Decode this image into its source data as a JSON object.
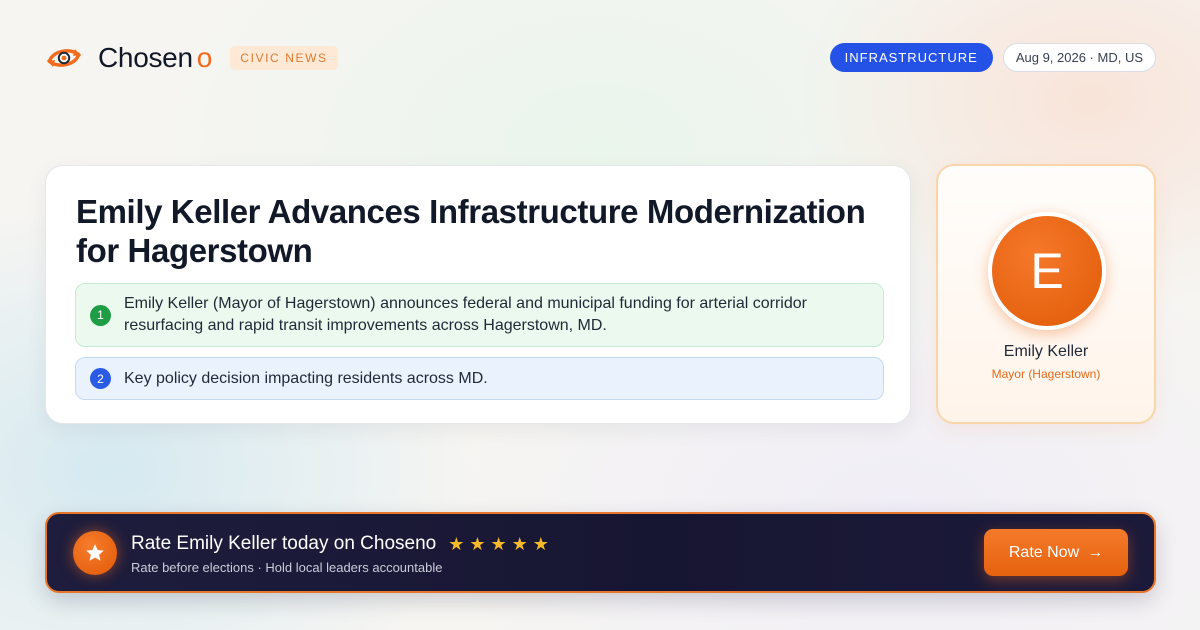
{
  "brand": {
    "name": "Chosen",
    "accent": "o",
    "tag": "CIVIC NEWS",
    "logo_icon": "eye-orbit-icon",
    "accent_color": "#f26a1b"
  },
  "header": {
    "category": "INFRASTRUCTURE",
    "date_location": "Aug 9, 2026 · MD, US",
    "category_color": "#2452e6"
  },
  "article": {
    "headline": "Emily Keller Advances Infrastructure  Modernization for Hagerstown",
    "points": [
      {
        "number": "1",
        "text": "Emily Keller (Mayor of Hagerstown) announces federal and municipal funding for arterial corridor resurfacing and rapid transit improvements across Hagerstown, MD."
      },
      {
        "number": "2",
        "text": "Key policy decision impacting residents across MD."
      }
    ]
  },
  "profile": {
    "initial": "E",
    "name": "Emily Keller",
    "role": "Mayor (Hagerstown)"
  },
  "cta": {
    "icon": "star-icon",
    "title": "Rate Emily Keller today on Chosen​o",
    "rating": 5,
    "subtitle": "Rate before elections · Hold local leaders accountable",
    "button_label": "Rate Now",
    "button_icon": "arrow-right-icon",
    "banner_color": "#1e1d3d",
    "button_color": "#f47a2a"
  }
}
